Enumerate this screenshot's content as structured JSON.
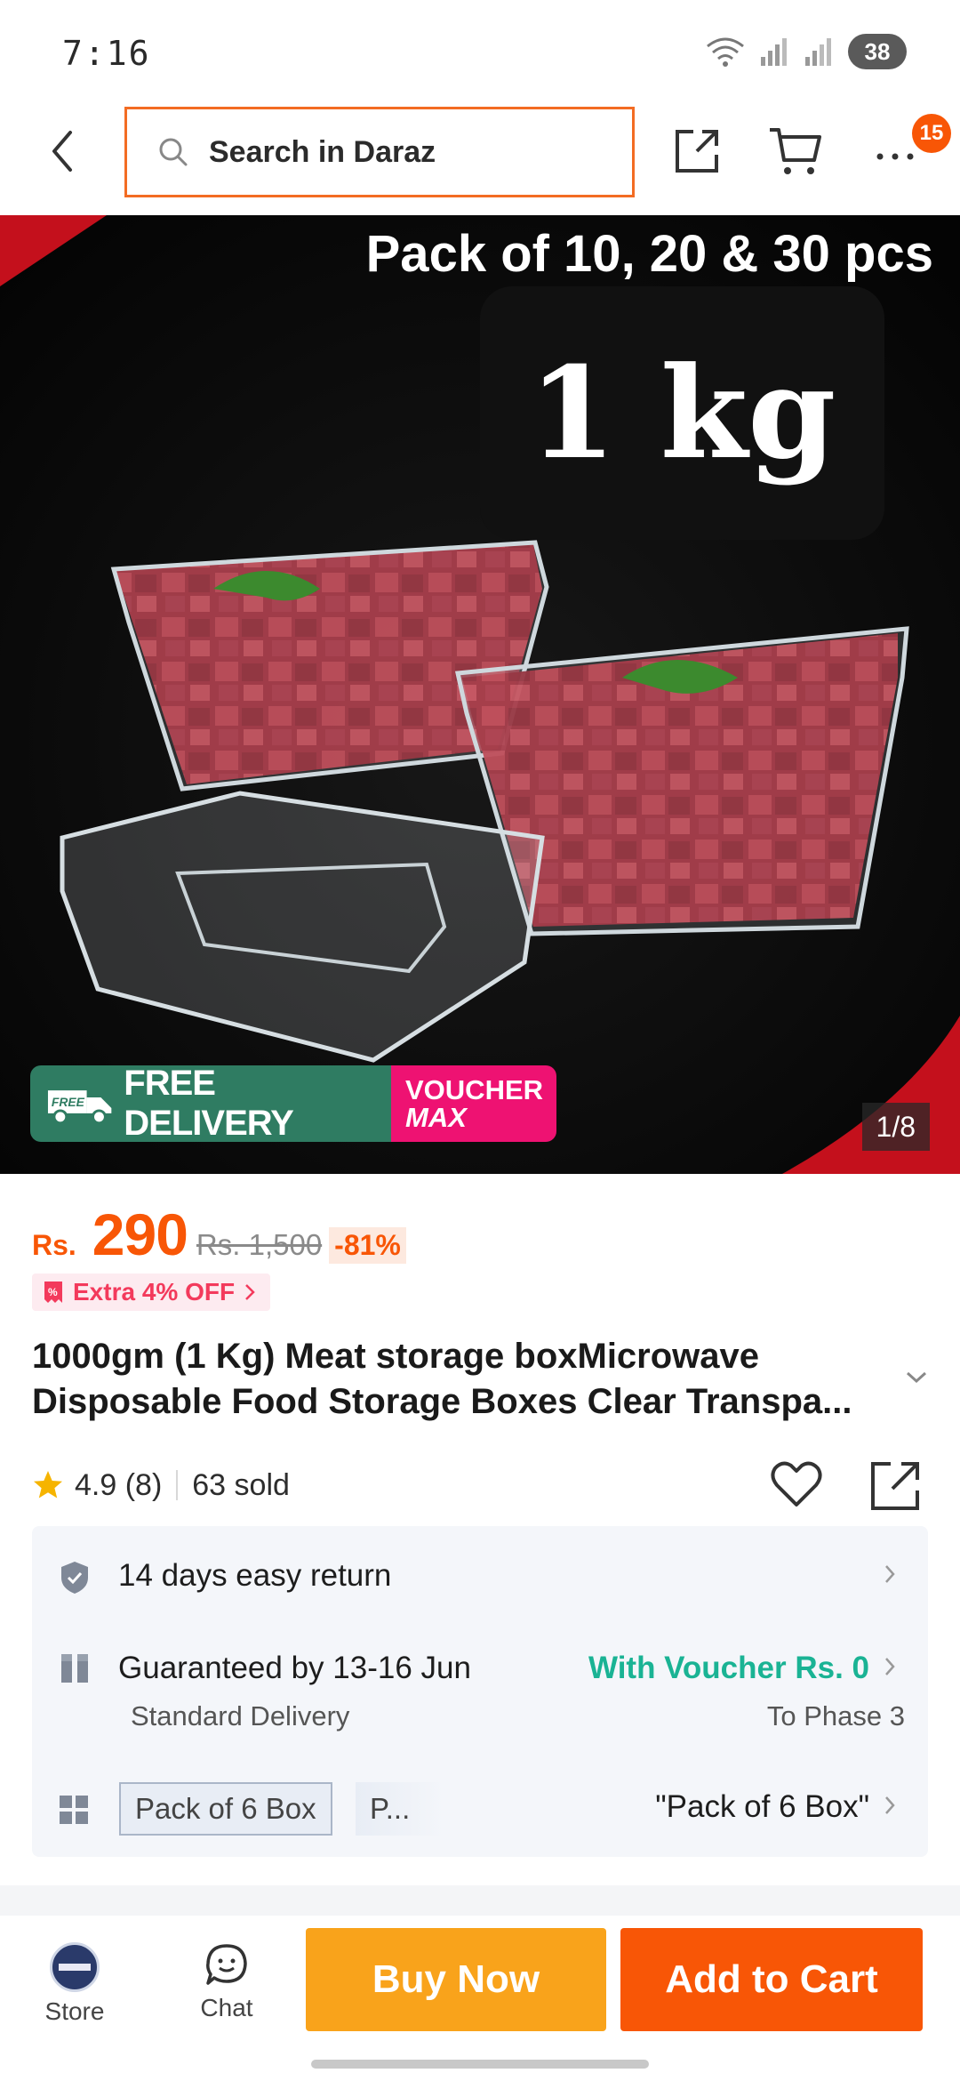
{
  "status": {
    "time": "7:16",
    "battery": "38"
  },
  "header": {
    "search_placeholder": "Search in Daraz",
    "cart_badge": "15"
  },
  "hero": {
    "headline": "Pack of 10, 20 & 30 pcs",
    "size_label": "1 kg",
    "free_badge": "FREE",
    "free_delivery": "FREE DELIVERY",
    "voucher_line1": "VOUCHER",
    "voucher_line2": "MAX",
    "counter": "1/8"
  },
  "product": {
    "currency": "Rs.",
    "price": "290",
    "original_price": "Rs. 1,500",
    "discount": "-81%",
    "promo": "Extra 4% OFF",
    "title": "1000gm (1 Kg) Meat storage boxMicrowave Disposable Food Storage Boxes Clear Transpa...",
    "rating": "4.9 (8)",
    "sold": "63 sold"
  },
  "info": {
    "return_text": "14 days easy return",
    "delivery_text": "Guaranteed by 13-16 Jun",
    "delivery_sub": "Standard Delivery",
    "voucher_text": "With Voucher Rs. 0",
    "phase_text": "To Phase 3",
    "option_chip": "Pack of 6 Box",
    "option_chip2": "P...",
    "option_selected": "\"Pack of 6 Box\""
  },
  "bottom": {
    "store_label": "Store",
    "chat_label": "Chat",
    "buy_now": "Buy Now",
    "add_to_cart": "Add to Cart"
  },
  "colors": {
    "accent": "#f85606",
    "buy": "#f9a31b",
    "green": "#1ab394",
    "voucher": "#ee1272",
    "delivery_green": "#2f7c62"
  }
}
